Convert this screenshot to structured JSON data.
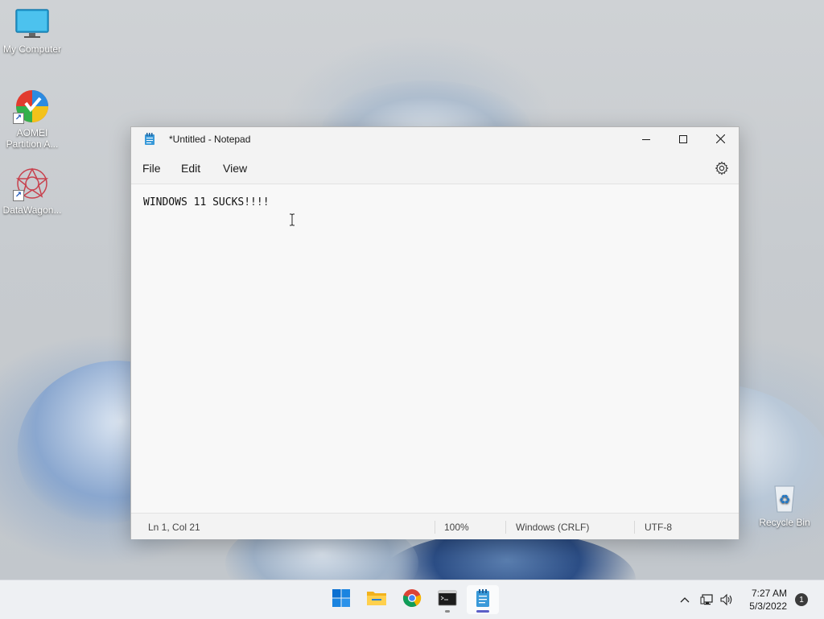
{
  "desktop": {
    "icons": [
      {
        "label": "My Computer"
      },
      {
        "label": "AOMEI Partition A..."
      },
      {
        "label": "DataWagon..."
      },
      {
        "label": "Recycle Bin"
      }
    ]
  },
  "notepad": {
    "title": "*Untitled - Notepad",
    "menu": {
      "file": "File",
      "edit": "Edit",
      "view": "View"
    },
    "content": "WINDOWS 11 SUCKS!!!!",
    "status": {
      "position": "Ln 1, Col 21",
      "zoom": "100%",
      "line_ending": "Windows (CRLF)",
      "encoding": "UTF-8"
    }
  },
  "taskbar": {
    "apps": [
      "windows-start-icon",
      "file-explorer-icon",
      "chrome-icon",
      "terminal-icon",
      "notepad-icon"
    ],
    "clock": {
      "time": "7:27 AM",
      "date": "5/3/2022"
    },
    "notification_count": "1"
  },
  "colors": {
    "accent": "#0067c0",
    "taskbar_bg": "#eef0f3",
    "window_bg": "#f8f8f8"
  }
}
